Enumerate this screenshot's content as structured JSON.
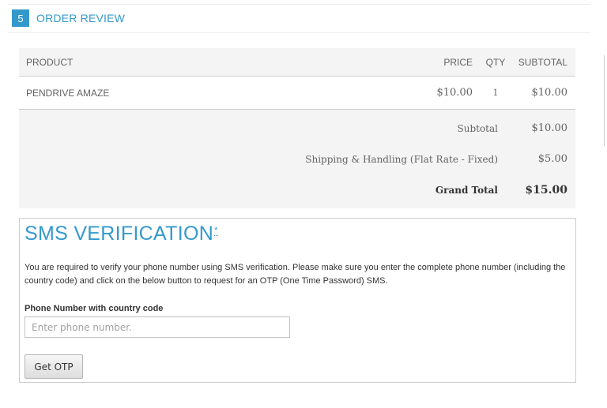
{
  "step": {
    "number": "5",
    "title": "Order Review"
  },
  "order": {
    "columns": {
      "product": "Product",
      "price": "Price",
      "qty": "Qty",
      "subtotal": "Subtotal"
    },
    "items": [
      {
        "product": "Pendrive Amaze",
        "price": "$10.00",
        "qty": "1",
        "subtotal": "$10.00"
      }
    ],
    "totals": {
      "subtotal_label": "Subtotal",
      "subtotal_value": "$10.00",
      "shipping_label": "Shipping & Handling (Flat Rate - Fixed)",
      "shipping_value": "$5.00",
      "grand_label": "Grand Total",
      "grand_value": "$15.00"
    }
  },
  "sms": {
    "title": "SMS Verification",
    "required_marker": "*",
    "description": "You are required to verify your phone number using SMS verification. Please make sure you enter the complete phone number (including the country code) and click on the below button to request for an OTP (One Time Password) SMS.",
    "phone_label": "Phone Number with country code",
    "phone_placeholder": "Enter phone number.",
    "phone_value": "",
    "button_label": "Get OTP"
  },
  "colors": {
    "accent": "#3399cc",
    "panel_bg": "#f4f4f4",
    "text": "#636363"
  }
}
